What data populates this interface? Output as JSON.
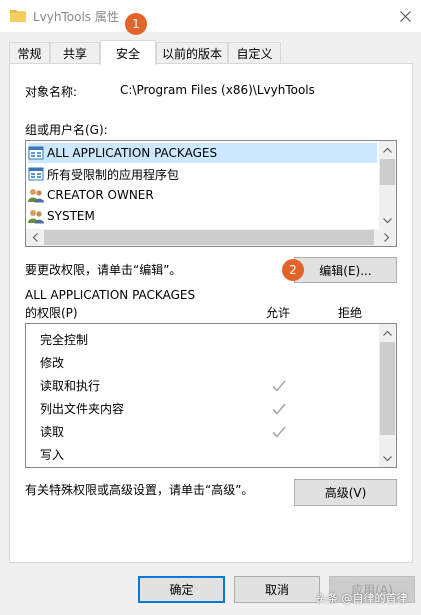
{
  "window": {
    "title": "LvyhTools 属性",
    "close_label": "×"
  },
  "badges": {
    "step1": "1",
    "step2": "2"
  },
  "tabs": [
    {
      "label": "常规"
    },
    {
      "label": "共享"
    },
    {
      "label": "安全",
      "active": true
    },
    {
      "label": "以前的版本"
    },
    {
      "label": "自定义"
    }
  ],
  "security": {
    "object_name_label": "对象名称:",
    "object_name_value": "C:\\Program Files (x86)\\LvyhTools",
    "groups_label": "组或用户名(G):",
    "groups": [
      {
        "name": "ALL APPLICATION PACKAGES",
        "icon": "app-packages-icon",
        "selected": true
      },
      {
        "name": "所有受限制的应用程序包",
        "icon": "app-packages-icon",
        "selected": false
      },
      {
        "name": "CREATOR OWNER",
        "icon": "users-icon",
        "selected": false
      },
      {
        "name": "SYSTEM",
        "icon": "users-icon",
        "selected": false
      }
    ],
    "edit_hint": "要更改权限，请单击“编辑”。",
    "edit_button": "编辑(E)...",
    "perm_for_line1": "ALL APPLICATION PACKAGES",
    "perm_for_line2": "的权限(P)",
    "allow_header": "允许",
    "deny_header": "拒绝",
    "permissions": [
      {
        "name": "完全控制",
        "allow": false,
        "deny": false
      },
      {
        "name": "修改",
        "allow": false,
        "deny": false
      },
      {
        "name": "读取和执行",
        "allow": true,
        "deny": false
      },
      {
        "name": "列出文件夹内容",
        "allow": true,
        "deny": false
      },
      {
        "name": "读取",
        "allow": true,
        "deny": false
      },
      {
        "name": "写入",
        "allow": false,
        "deny": false
      }
    ],
    "advanced_hint": "有关特殊权限或高级设置，请单击“高级”。",
    "advanced_button": "高级(V)"
  },
  "footer": {
    "ok": "确定",
    "cancel": "取消",
    "apply": "应用(A)"
  },
  "watermark": "头条 @自律的首律",
  "colors": {
    "accent": "#0078d7",
    "badge": "#e3642b",
    "selection": "#cce8ff",
    "check": "#a9a9a9"
  }
}
